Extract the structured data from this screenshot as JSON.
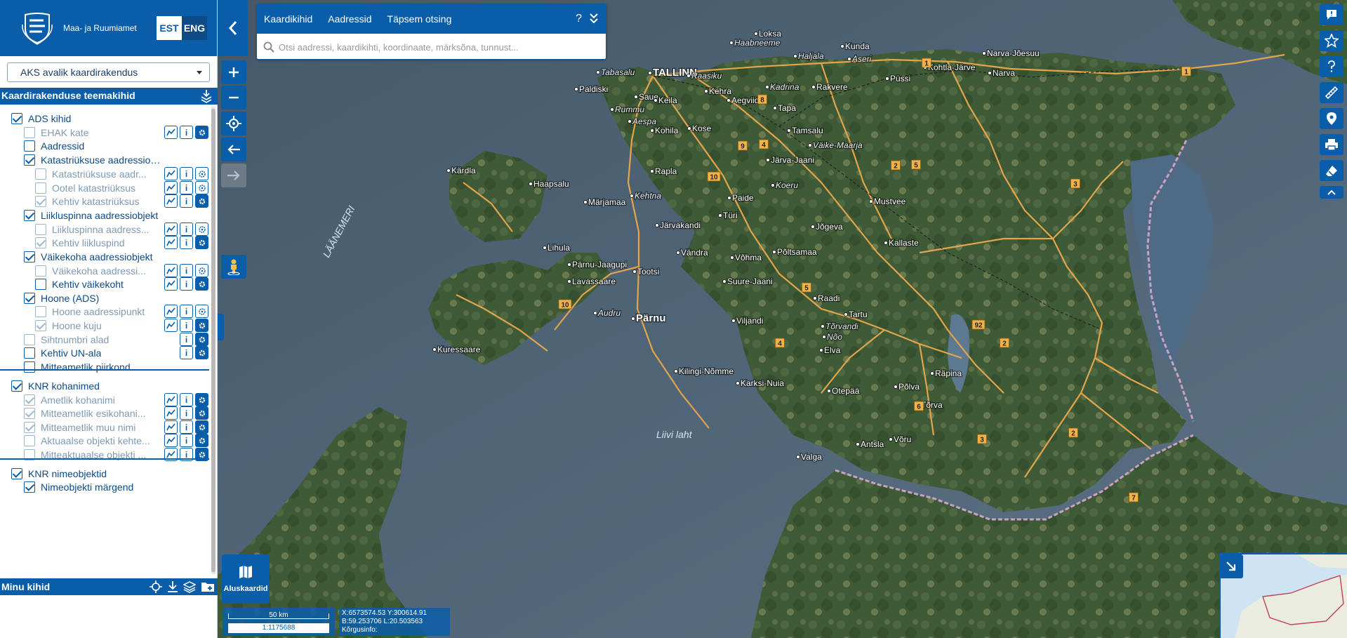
{
  "header": {
    "org_name": "Maa- ja Ruumiamet",
    "lang_est": "EST",
    "lang_eng": "ENG"
  },
  "app_select": {
    "value": "AKS avalik kaardirakendus"
  },
  "theme_panel": {
    "title": "Kaardirakenduse teemakihid"
  },
  "layers": [
    {
      "label": "ADS kihid",
      "level": 0,
      "checked": true,
      "dim": false,
      "tools": ""
    },
    {
      "label": "EHAK kate",
      "level": 1,
      "checked": false,
      "dim": true,
      "tools": "tif"
    },
    {
      "label": "Aadressid",
      "level": 1,
      "checked": false,
      "dim": false,
      "tools": ""
    },
    {
      "label": "Katastriüksuse aadressiobjekt",
      "level": 1,
      "checked": true,
      "dim": false,
      "tools": ""
    },
    {
      "label": "Katastriüksuse aadr...",
      "level": 2,
      "checked": false,
      "dim": true,
      "tools": "tio"
    },
    {
      "label": "Ootel katastriüksus",
      "level": 2,
      "checked": false,
      "dim": true,
      "tools": "tio"
    },
    {
      "label": "Kehtiv katastriüksus",
      "level": 2,
      "checked": true,
      "dim": true,
      "tools": "tif"
    },
    {
      "label": "Liikluspinna aadressiobjekt",
      "level": 1,
      "checked": true,
      "dim": false,
      "tools": ""
    },
    {
      "label": "Liikluspinna aadress...",
      "level": 2,
      "checked": false,
      "dim": true,
      "tools": "tio"
    },
    {
      "label": "Kehtiv liikluspind",
      "level": 2,
      "checked": true,
      "dim": true,
      "tools": "tif"
    },
    {
      "label": "Väikekoha aadressiobjekt",
      "level": 1,
      "checked": true,
      "dim": false,
      "tools": ""
    },
    {
      "label": "Väikekoha aadressi...",
      "level": 2,
      "checked": false,
      "dim": true,
      "tools": "tio"
    },
    {
      "label": "Kehtiv väikekoht",
      "level": 2,
      "checked": false,
      "dim": false,
      "tools": "tif"
    },
    {
      "label": "Hoone (ADS)",
      "level": 1,
      "checked": true,
      "dim": false,
      "tools": ""
    },
    {
      "label": "Hoone aadressipunkt",
      "level": 2,
      "checked": false,
      "dim": true,
      "tools": "tio"
    },
    {
      "label": "Hoone kuju",
      "level": 2,
      "checked": true,
      "dim": true,
      "tools": "tif"
    },
    {
      "label": "Sihtnumbri alad",
      "level": 1,
      "checked": false,
      "dim": true,
      "tools": "if"
    },
    {
      "label": "Kehtiv UN-ala",
      "level": 1,
      "checked": false,
      "dim": false,
      "tools": "if"
    },
    {
      "label": "Mitteametlik piirkond",
      "level": 1,
      "checked": false,
      "dim": false,
      "tools": ""
    },
    {
      "label": "KNR kohanimed",
      "level": 0,
      "checked": true,
      "dim": false,
      "tools": "",
      "sep": true
    },
    {
      "label": "Ametlik kohanimi",
      "level": 1,
      "checked": true,
      "dim": true,
      "tools": "tif"
    },
    {
      "label": "Mitteametlik esikohani...",
      "level": 1,
      "checked": true,
      "dim": true,
      "tools": "tif"
    },
    {
      "label": "Mitteametlik muu nimi",
      "level": 1,
      "checked": true,
      "dim": true,
      "tools": "tif"
    },
    {
      "label": "Aktuaalse objekti kehte...",
      "level": 1,
      "checked": false,
      "dim": true,
      "tools": "tif"
    },
    {
      "label": "Mitteaktuaalse objekti ...",
      "level": 1,
      "checked": false,
      "dim": true,
      "tools": "tif"
    },
    {
      "label": "KNR nimeobjektid",
      "level": 0,
      "checked": true,
      "dim": false,
      "tools": "",
      "sep": true
    },
    {
      "label": "Nimeobjekti märgend",
      "level": 1,
      "checked": true,
      "dim": false,
      "tools": ""
    }
  ],
  "my_layers": {
    "title": "Minu kihid"
  },
  "search": {
    "tab_map_layers": "Kaardikihid",
    "tab_addresses": "Aadressid",
    "tab_detailed": "Täpsem otsing",
    "help": "?",
    "placeholder": "Otsi aadressi, kaardikihti, koordinaate, märksõna, tunnust..."
  },
  "basemap": {
    "label": "Aluskaardid"
  },
  "scale": {
    "distance": "50 km",
    "ratio": "1:1175688"
  },
  "coords": {
    "xy": "X:6573574.53 Y:300614.91",
    "bl": "B:59.253706 L:20.503563",
    "height": "Kõrgusinfo:"
  },
  "map_labels": {
    "sea_1": "LÄÄNEMERI",
    "sea_2": "Liivi laht",
    "places": [
      {
        "name": "TALLINN",
        "big": true
      },
      {
        "name": "Loksa"
      },
      {
        "name": "Kunda"
      },
      {
        "name": "Haabneeme",
        "it": true
      },
      {
        "name": "Haljala",
        "it": true
      },
      {
        "name": "Aseri",
        "it": true
      },
      {
        "name": "Kohtla-Järve"
      },
      {
        "name": "Narva-Jõesuu"
      },
      {
        "name": "Narva"
      },
      {
        "name": "Tabasalu",
        "it": true
      },
      {
        "name": "Paldiski"
      },
      {
        "name": "Saue"
      },
      {
        "name": "Keila"
      },
      {
        "name": "Kehra"
      },
      {
        "name": "Raasiku",
        "it": true
      },
      {
        "name": "Aegviidu"
      },
      {
        "name": "Kadrina",
        "it": true
      },
      {
        "name": "Rakvere"
      },
      {
        "name": "Püssi"
      },
      {
        "name": "Tapa"
      },
      {
        "name": "Rummu",
        "it": true
      },
      {
        "name": "Aespa",
        "it": true
      },
      {
        "name": "Kohila"
      },
      {
        "name": "Kose"
      },
      {
        "name": "Tamsalu"
      },
      {
        "name": "Väike-Maarja",
        "it": true
      },
      {
        "name": "Järva-Jaani"
      },
      {
        "name": "Kärdla"
      },
      {
        "name": "Haapsalu"
      },
      {
        "name": "Rapla"
      },
      {
        "name": "Koeru",
        "it": true
      },
      {
        "name": "Märjamaa"
      },
      {
        "name": "Kehtna",
        "it": true
      },
      {
        "name": "Paide"
      },
      {
        "name": "Türi"
      },
      {
        "name": "Mustvee"
      },
      {
        "name": "Järvakandi"
      },
      {
        "name": "Jõgeva"
      },
      {
        "name": "Kallaste"
      },
      {
        "name": "Lihula"
      },
      {
        "name": "Vändra"
      },
      {
        "name": "Võhma"
      },
      {
        "name": "Põltsamaa"
      },
      {
        "name": "Pärnu-Jaagupi"
      },
      {
        "name": "Tootsi"
      },
      {
        "name": "Lavassaare"
      },
      {
        "name": "Suure-Jaani"
      },
      {
        "name": "Raadi"
      },
      {
        "name": "Tartu"
      },
      {
        "name": "Audru",
        "it": true
      },
      {
        "name": "Pärnu",
        "big": true
      },
      {
        "name": "Viljandi"
      },
      {
        "name": "Tõrvandi",
        "it": true
      },
      {
        "name": "Nõo",
        "it": true
      },
      {
        "name": "Elva"
      },
      {
        "name": "Kuressaare"
      },
      {
        "name": "Kilingi-Nõmme"
      },
      {
        "name": "Karksi-Nuia"
      },
      {
        "name": "Otepää"
      },
      {
        "name": "Põlva"
      },
      {
        "name": "Räpina"
      },
      {
        "name": "Tõrva"
      },
      {
        "name": "Antsla"
      },
      {
        "name": "Võru"
      },
      {
        "name": "Valga"
      }
    ],
    "roads": [
      "1",
      "1",
      "8",
      "4",
      "9",
      "2",
      "5",
      "10",
      "3",
      "5",
      "10",
      "2",
      "92",
      "4",
      "6",
      "3",
      "2",
      "7"
    ]
  }
}
